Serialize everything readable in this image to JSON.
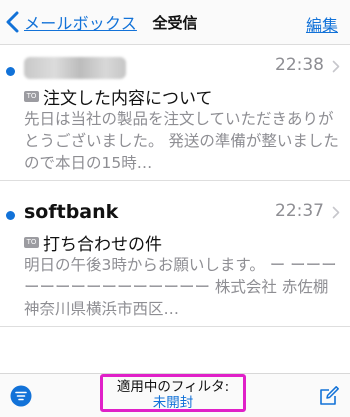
{
  "navbar": {
    "back_label": "メールボックス",
    "title": "全受信",
    "edit_label": "編集"
  },
  "messages": [
    {
      "sender": "",
      "sender_obscured": true,
      "time": "22:38",
      "unread": true,
      "subject": "注文した内容について",
      "preview": "先日は当社の製品を注文していただきありがとうございました。 発送の準備が整いましたので本日の15時…"
    },
    {
      "sender": "softbank",
      "sender_obscured": false,
      "time": "22:37",
      "unread": true,
      "subject": "打ち合わせの件",
      "preview": "明日の午後3時からお願いします。 ー ーーーーーーーーーーーーーーー 株式会社 赤佐棚 神奈川県横浜市西区…"
    }
  ],
  "toolbar": {
    "filter_heading": "適用中のフィルタ:",
    "filter_value": "未開封"
  },
  "colors": {
    "accent": "#1272d8",
    "highlight_border": "#e020c8",
    "secondary_text": "#8e8e93"
  },
  "icons": {
    "back": "chevron-left-icon",
    "disclosure": "chevron-right-icon",
    "tag": "message-tag-icon",
    "filter": "filter-icon",
    "compose": "compose-icon"
  }
}
